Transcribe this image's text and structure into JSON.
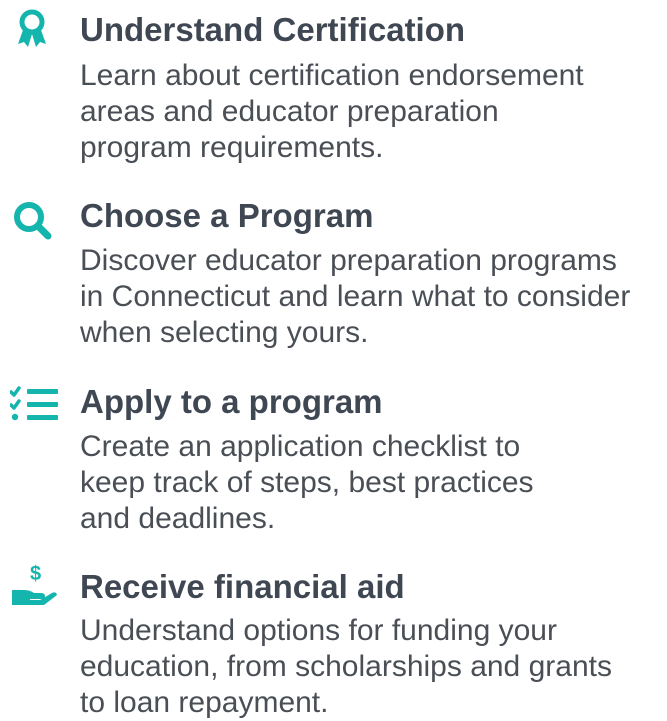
{
  "accent_color": "#13b5ad",
  "steps": [
    {
      "icon": "ribbon-award-icon",
      "title": "Understand Certification",
      "description_lines": [
        "Learn about certification endorsement",
        "areas and educator preparation",
        "program requirements."
      ]
    },
    {
      "icon": "search-icon",
      "title": "Choose a Program",
      "description_lines": [
        "Discover educator preparation programs",
        "in Connecticut and learn what to consider",
        "when selecting yours."
      ]
    },
    {
      "icon": "checklist-icon",
      "title": "Apply to a program",
      "description_lines": [
        "Create an application checklist to",
        "keep track of steps, best practices",
        "and deadlines."
      ]
    },
    {
      "icon": "hand-dollar-icon",
      "title": "Receive financial aid",
      "description_lines": [
        "Understand options for funding your",
        "education, from scholarships and grants",
        "to loan repayment."
      ]
    }
  ]
}
